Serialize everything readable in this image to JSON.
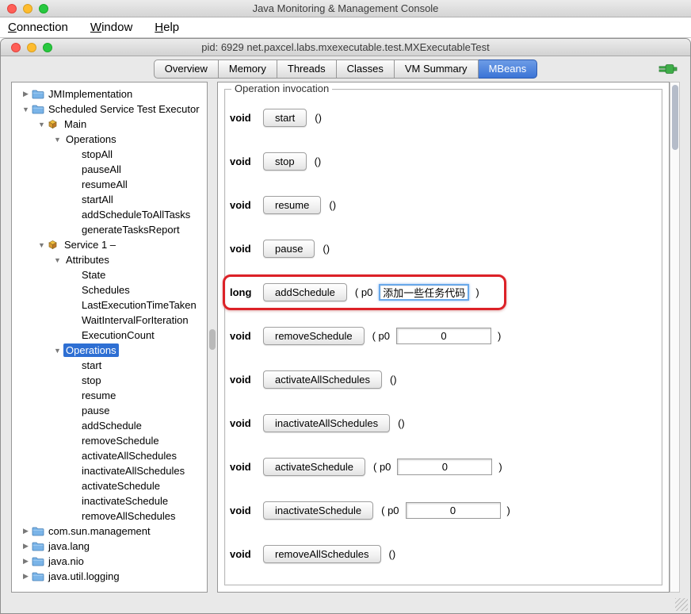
{
  "colors": {
    "tab_selected": "#3b74d6",
    "tree_selection": "#2e6fd3",
    "annotation_red": "#dc2127",
    "connected_green": "#3fae49"
  },
  "window": {
    "title": "Java Monitoring & Management Console",
    "menu": [
      "Connection",
      "Window",
      "Help"
    ]
  },
  "inner_window": {
    "title": "pid: 6929 net.paxcel.labs.mxexecutable.test.MXExecutableTest",
    "tabs": [
      {
        "label": "Overview",
        "selected": false
      },
      {
        "label": "Memory",
        "selected": false
      },
      {
        "label": "Threads",
        "selected": false
      },
      {
        "label": "Classes",
        "selected": false
      },
      {
        "label": "VM Summary",
        "selected": false
      },
      {
        "label": "MBeans",
        "selected": true
      }
    ],
    "status_icon": "connected-plug-icon"
  },
  "tree": {
    "items": [
      {
        "label": "JMImplementation",
        "depth": 0,
        "disclosure": "collapsed",
        "icon": "folder",
        "selected": false
      },
      {
        "label": "Scheduled Service Test Executor",
        "depth": 0,
        "disclosure": "expanded",
        "icon": "folder",
        "selected": false
      },
      {
        "label": "Main",
        "depth": 1,
        "disclosure": "expanded",
        "icon": "mbean",
        "selected": false
      },
      {
        "label": "Operations",
        "depth": 2,
        "disclosure": "expanded",
        "icon": "none",
        "selected": false
      },
      {
        "label": "stopAll",
        "depth": 3,
        "disclosure": "none",
        "icon": "none",
        "selected": false
      },
      {
        "label": "pauseAll",
        "depth": 3,
        "disclosure": "none",
        "icon": "none",
        "selected": false
      },
      {
        "label": "resumeAll",
        "depth": 3,
        "disclosure": "none",
        "icon": "none",
        "selected": false
      },
      {
        "label": "startAll",
        "depth": 3,
        "disclosure": "none",
        "icon": "none",
        "selected": false
      },
      {
        "label": "addScheduleToAllTasks",
        "depth": 3,
        "disclosure": "none",
        "icon": "none",
        "selected": false
      },
      {
        "label": "generateTasksReport",
        "depth": 3,
        "disclosure": "none",
        "icon": "none",
        "selected": false
      },
      {
        "label": "Service 1 –",
        "depth": 1,
        "disclosure": "expanded",
        "icon": "mbean",
        "selected": false
      },
      {
        "label": "Attributes",
        "depth": 2,
        "disclosure": "expanded",
        "icon": "none",
        "selected": false
      },
      {
        "label": "State",
        "depth": 3,
        "disclosure": "none",
        "icon": "none",
        "selected": false
      },
      {
        "label": "Schedules",
        "depth": 3,
        "disclosure": "none",
        "icon": "none",
        "selected": false
      },
      {
        "label": "LastExecutionTimeTaken",
        "depth": 3,
        "disclosure": "none",
        "icon": "none",
        "selected": false
      },
      {
        "label": "WaitIntervalForIteration",
        "depth": 3,
        "disclosure": "none",
        "icon": "none",
        "selected": false
      },
      {
        "label": "ExecutionCount",
        "depth": 3,
        "disclosure": "none",
        "icon": "none",
        "selected": false
      },
      {
        "label": "Operations",
        "depth": 2,
        "disclosure": "expanded",
        "icon": "none",
        "selected": true
      },
      {
        "label": "start",
        "depth": 3,
        "disclosure": "none",
        "icon": "none",
        "selected": false
      },
      {
        "label": "stop",
        "depth": 3,
        "disclosure": "none",
        "icon": "none",
        "selected": false
      },
      {
        "label": "resume",
        "depth": 3,
        "disclosure": "none",
        "icon": "none",
        "selected": false
      },
      {
        "label": "pause",
        "depth": 3,
        "disclosure": "none",
        "icon": "none",
        "selected": false
      },
      {
        "label": "addSchedule",
        "depth": 3,
        "disclosure": "none",
        "icon": "none",
        "selected": false
      },
      {
        "label": "removeSchedule",
        "depth": 3,
        "disclosure": "none",
        "icon": "none",
        "selected": false
      },
      {
        "label": "activateAllSchedules",
        "depth": 3,
        "disclosure": "none",
        "icon": "none",
        "selected": false
      },
      {
        "label": "inactivateAllSchedules",
        "depth": 3,
        "disclosure": "none",
        "icon": "none",
        "selected": false
      },
      {
        "label": "activateSchedule",
        "depth": 3,
        "disclosure": "none",
        "icon": "none",
        "selected": false
      },
      {
        "label": "inactivateSchedule",
        "depth": 3,
        "disclosure": "none",
        "icon": "none",
        "selected": false
      },
      {
        "label": "removeAllSchedules",
        "depth": 3,
        "disclosure": "none",
        "icon": "none",
        "selected": false
      },
      {
        "label": "com.sun.management",
        "depth": 0,
        "disclosure": "collapsed",
        "icon": "folder",
        "selected": false
      },
      {
        "label": "java.lang",
        "depth": 0,
        "disclosure": "collapsed",
        "icon": "folder",
        "selected": false
      },
      {
        "label": "java.nio",
        "depth": 0,
        "disclosure": "collapsed",
        "icon": "folder",
        "selected": false
      },
      {
        "label": "java.util.logging",
        "depth": 0,
        "disclosure": "collapsed",
        "icon": "folder",
        "selected": false
      }
    ]
  },
  "operations_panel": {
    "title": "Operation invocation",
    "rows": [
      {
        "return_type": "void",
        "name": "start",
        "args": "()",
        "highlighted": false
      },
      {
        "return_type": "void",
        "name": "stop",
        "args": "()",
        "highlighted": false
      },
      {
        "return_type": "void",
        "name": "resume",
        "args": "()",
        "highlighted": false
      },
      {
        "return_type": "void",
        "name": "pause",
        "args": "()",
        "highlighted": false
      },
      {
        "return_type": "long",
        "name": "addSchedule",
        "param_label": "p0",
        "param_value": "添加一些任务代码",
        "focused": true,
        "highlighted": true
      },
      {
        "return_type": "void",
        "name": "removeSchedule",
        "param_label": "p0",
        "param_value": "0",
        "focused": false,
        "highlighted": false
      },
      {
        "return_type": "void",
        "name": "activateAllSchedules",
        "args": "()",
        "highlighted": false
      },
      {
        "return_type": "void",
        "name": "inactivateAllSchedules",
        "args": "()",
        "highlighted": false
      },
      {
        "return_type": "void",
        "name": "activateSchedule",
        "param_label": "p0",
        "param_value": "0",
        "focused": false,
        "highlighted": false
      },
      {
        "return_type": "void",
        "name": "inactivateSchedule",
        "param_label": "p0",
        "param_value": "0",
        "focused": false,
        "highlighted": false
      },
      {
        "return_type": "void",
        "name": "removeAllSchedules",
        "args": "()",
        "highlighted": false
      }
    ]
  }
}
